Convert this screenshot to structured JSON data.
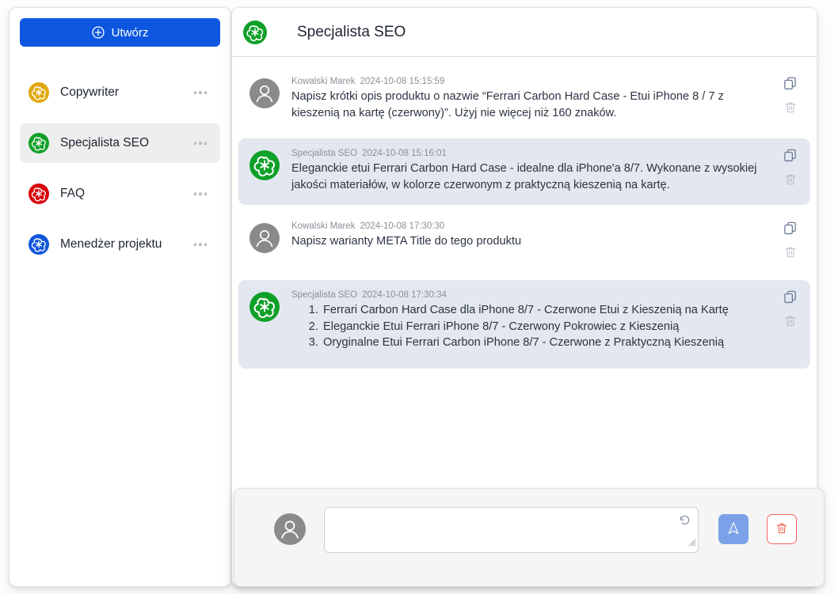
{
  "sidebar": {
    "create_button": {
      "label": "Utwórz",
      "icon": "plus-circle-icon",
      "color": "#0d57e0"
    },
    "items": [
      {
        "label": "Copywriter",
        "icon": "openai-logo-icon",
        "color": "#e0a80c",
        "selected": false,
        "menu_icon": "ellipsis-icon"
      },
      {
        "label": "Specjalista SEO",
        "icon": "openai-logo-icon",
        "color": "#0fa028",
        "selected": true,
        "menu_icon": "ellipsis-icon"
      },
      {
        "label": "FAQ",
        "icon": "openai-logo-icon",
        "color": "#d9000a",
        "selected": false,
        "menu_icon": "ellipsis-icon"
      },
      {
        "label": "Menedżer projektu",
        "icon": "openai-logo-icon",
        "color": "#0f56dd",
        "selected": false,
        "menu_icon": "ellipsis-icon"
      }
    ]
  },
  "header": {
    "title": "Specjalista SEO",
    "avatar_icon": "openai-logo-icon",
    "avatar_color": "#0fa028"
  },
  "messages": [
    {
      "role": "user",
      "author": "Kowalski Marek",
      "timestamp": "2024-10-08 15:15:59",
      "avatar_icon": "user-avatar-icon",
      "text": "Napisz krótki opis produktu o nazwie “Ferrari Carbon Hard Case - Etui iPhone 8 / 7 z kieszenią na kartę (czerwony)”. Użyj nie więcej niż 160 znaków.",
      "copy_icon": "copy-icon",
      "delete_icon": "trash-icon"
    },
    {
      "role": "assistant",
      "author": "Specjalista SEO",
      "timestamp": "2024-10-08 15:16:01",
      "avatar_icon": "openai-logo-icon",
      "text": "Eleganckie etui Ferrari Carbon Hard Case - idealne dla iPhone'a 8/7. Wykonane z wysokiej jakości materiałów, w kolorze czerwonym z praktyczną kieszenią na kartę.",
      "copy_icon": "copy-icon",
      "delete_icon": "trash-icon"
    },
    {
      "role": "user",
      "author": "Kowalski Marek",
      "timestamp": "2024-10-08 17:30:30",
      "avatar_icon": "user-avatar-icon",
      "text": "Napisz warianty META Title do tego produktu",
      "copy_icon": "copy-icon",
      "delete_icon": "trash-icon"
    },
    {
      "role": "assistant",
      "author": "Specjalista SEO",
      "timestamp": "2024-10-08 17:30:34",
      "avatar_icon": "openai-logo-icon",
      "list": [
        "Ferrari Carbon Hard Case dla iPhone 8/7 - Czerwone Etui z Kieszenią na Kartę",
        "Eleganckie Etui Ferrari iPhone 8/7 - Czerwony Pokrowiec z Kieszenią",
        "Oryginalne Etui Ferrari Carbon iPhone 8/7 - Czerwone z Praktyczną Kieszenią"
      ],
      "copy_icon": "copy-icon",
      "delete_icon": "trash-icon"
    }
  ],
  "composer": {
    "avatar_icon": "user-avatar-icon",
    "input_value": "",
    "input_placeholder": "",
    "history_icon": "history-rotate-icon",
    "send_icon": "send-plane-icon",
    "send_color": "#7ba2e8",
    "clear_icon": "trash-icon",
    "clear_color": "#f2655a"
  }
}
